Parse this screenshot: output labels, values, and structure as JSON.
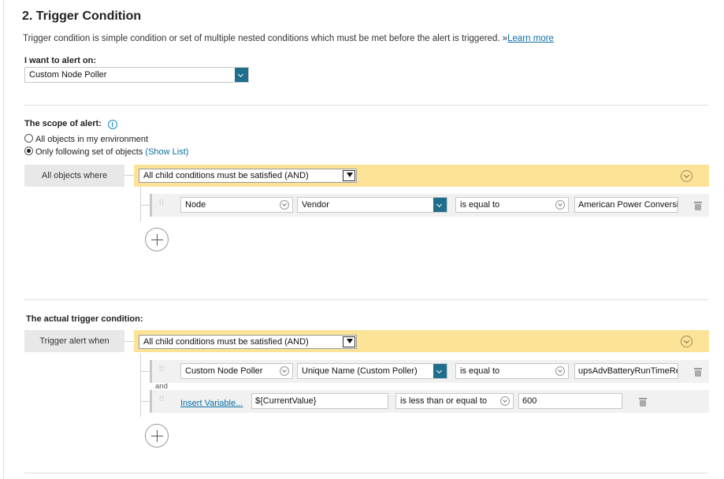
{
  "section": {
    "title": "2. Trigger Condition",
    "description": "Trigger condition is simple condition or set of multiple nested conditions which must be met before the alert is triggered. »",
    "learn_more": "Learn more"
  },
  "alert_on": {
    "label": "I want to alert on:",
    "value": "Custom Node Poller"
  },
  "scope": {
    "label": "The scope of alert:",
    "info_icon": "info-icon",
    "options": [
      {
        "label": "All objects in my environment",
        "selected": false
      },
      {
        "label": "Only following set of objects",
        "selected": true
      }
    ],
    "show_list": "(Show List)",
    "group_label": "All objects where",
    "group_operator": "All child conditions must be satisfied (AND)",
    "conditions": [
      {
        "object": "Node",
        "field": "Vendor",
        "operator": "is equal to",
        "value": "American Power Conversion Corp."
      }
    ]
  },
  "trigger": {
    "label": "The actual trigger condition:",
    "group_label": "Trigger alert when",
    "group_operator": "All child conditions must be satisfied (AND)",
    "conditions": [
      {
        "object": "Custom Node Poller",
        "field": "Unique Name (Custom Poller)",
        "operator": "is equal to",
        "value": "upsAdvBatteryRunTimeRemaining"
      },
      {
        "insert_variable": "Insert Variable...",
        "variable": "${CurrentValue}",
        "operator": "is less than or equal to",
        "value": "600"
      }
    ],
    "joiner": "and"
  },
  "colors": {
    "accent": "#1f6e8c",
    "group_bar": "#fde398",
    "link": "#0a6ea6"
  }
}
